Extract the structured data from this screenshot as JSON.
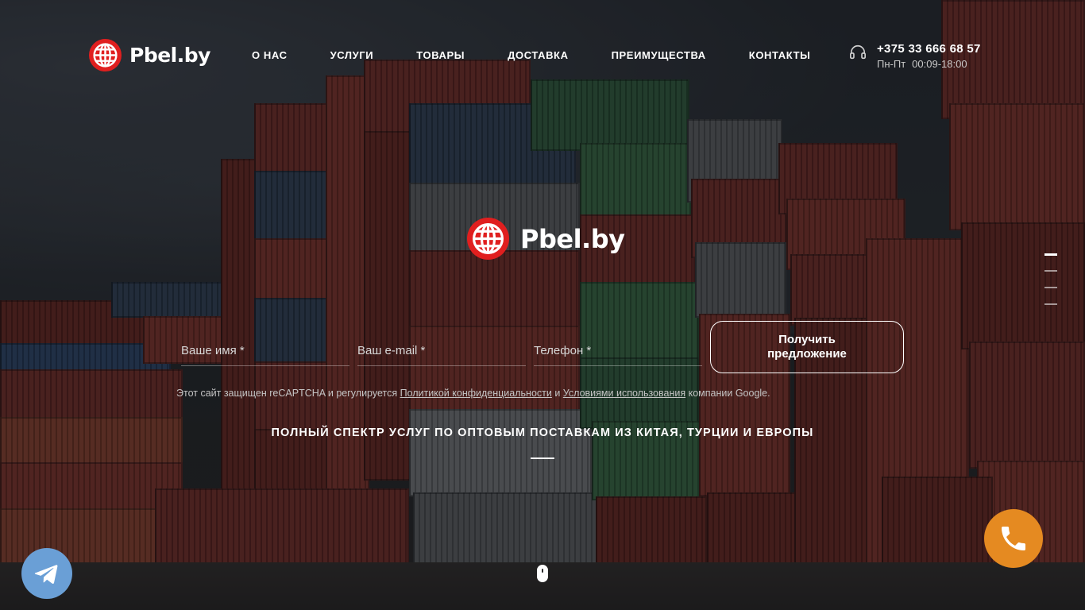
{
  "header": {
    "brand": "Pbel.by",
    "nav": [
      {
        "label": "О НАС"
      },
      {
        "label": "УСЛУГИ"
      },
      {
        "label": "ТОВАРЫ"
      },
      {
        "label": "ДОСТАВКА"
      },
      {
        "label": "ПРЕИМУЩЕСТВА"
      },
      {
        "label": "КОНТАКТЫ"
      }
    ],
    "phone": {
      "number": "+375 33 666 68 57",
      "days": "Пн-Пт",
      "hours": "00:09-18:00",
      "icon": "headset-icon"
    }
  },
  "hero": {
    "brand": "Pbel.by",
    "form": {
      "name_placeholder": "Ваше имя *",
      "email_placeholder": "Ваш e-mail *",
      "phone_placeholder": "Телефон *",
      "name_value": "",
      "email_value": "",
      "phone_value": "",
      "submit_line1": "Получить",
      "submit_line2": "предложение"
    },
    "recaptcha": {
      "prefix": "Этот сайт защищен reCAPTCHA и регулируется ",
      "privacy_link": "Политикой конфиденциальности",
      "middle": " и ",
      "terms_link": "Условиями использования",
      "suffix": " компании Google."
    },
    "tagline": "ПОЛНЫЙ СПЕКТР УСЛУГ ПО ОПТОВЫМ ПОСТАВКАМ ИЗ КИТАЯ, ТУРЦИИ И ЕВРОПЫ"
  },
  "slider": {
    "count": 4,
    "active": 1
  },
  "floating": {
    "telegram_icon": "telegram-icon",
    "call_icon": "phone-icon"
  },
  "colors": {
    "brand_red": "#e01f1f",
    "call_orange": "#e58a21",
    "telegram_blue": "#6a9fd6"
  }
}
